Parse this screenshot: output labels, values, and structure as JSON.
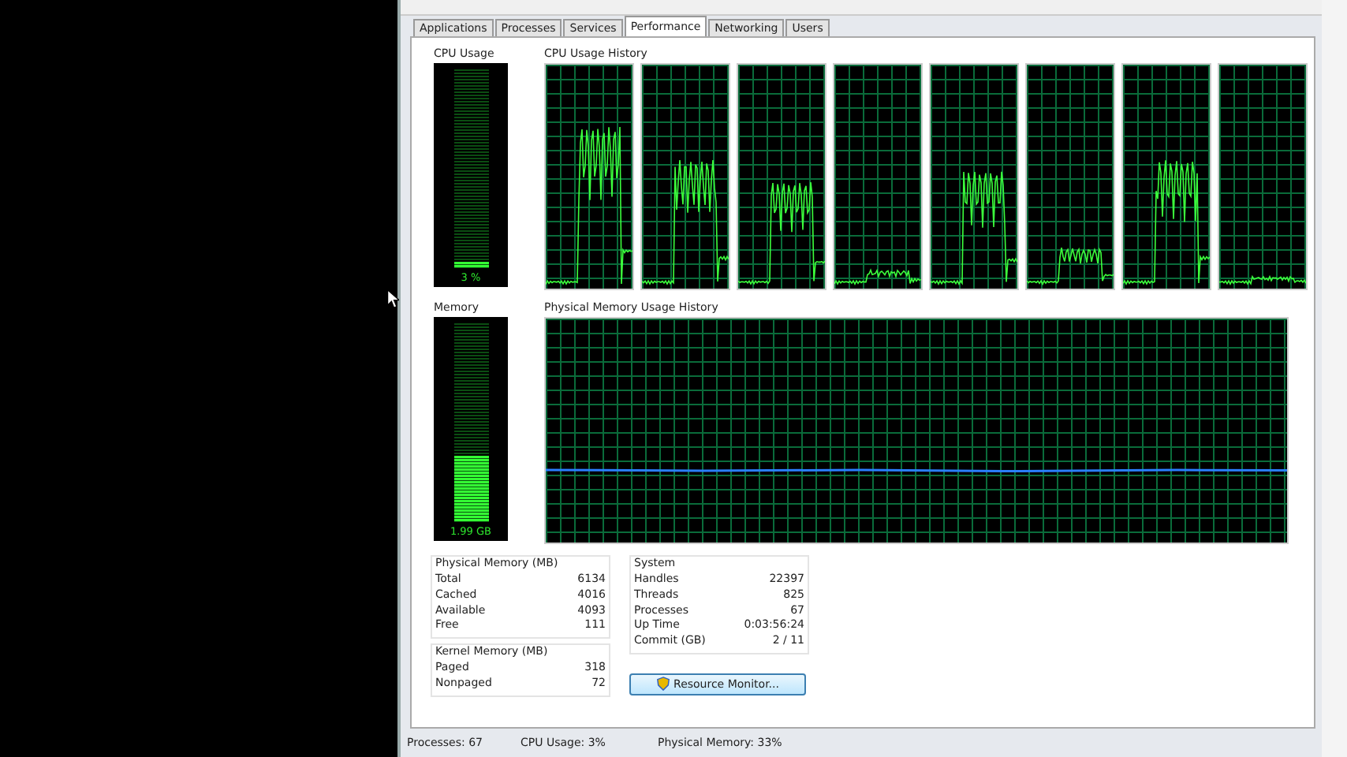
{
  "tabs": [
    {
      "label": "Applications",
      "selected": false
    },
    {
      "label": "Processes",
      "selected": false
    },
    {
      "label": "Services",
      "selected": false
    },
    {
      "label": "Performance",
      "selected": true
    },
    {
      "label": "Networking",
      "selected": false
    },
    {
      "label": "Users",
      "selected": false
    }
  ],
  "cpu_usage": {
    "label": "CPU Usage",
    "level": 0.03,
    "reading": "3 %"
  },
  "cpu_history": {
    "label": "CPU Usage History"
  },
  "memory": {
    "label": "Memory",
    "level": 0.33,
    "reading": "1.99 GB"
  },
  "memory_history": {
    "label": "Physical Memory Usage History"
  },
  "physical_memory": {
    "title": "Physical Memory (MB)",
    "rows": [
      {
        "label": "Total",
        "value": "6134"
      },
      {
        "label": "Cached",
        "value": "4016"
      },
      {
        "label": "Available",
        "value": "4093"
      },
      {
        "label": "Free",
        "value": "111"
      }
    ]
  },
  "kernel_memory": {
    "title": "Kernel Memory (MB)",
    "rows": [
      {
        "label": "Paged",
        "value": "318"
      },
      {
        "label": "Nonpaged",
        "value": "72"
      }
    ]
  },
  "system": {
    "title": "System",
    "rows": [
      {
        "label": "Handles",
        "value": "22397"
      },
      {
        "label": "Threads",
        "value": "825"
      },
      {
        "label": "Processes",
        "value": "67"
      },
      {
        "label": "Up Time",
        "value": "0:03:56:24"
      },
      {
        "label": "Commit (GB)",
        "value": "2 / 11"
      }
    ]
  },
  "resource_monitor_button": "Resource Monitor...",
  "status_bar": [
    "Processes: 67",
    "CPU Usage: 3%",
    "Physical Memory: 33%"
  ]
}
